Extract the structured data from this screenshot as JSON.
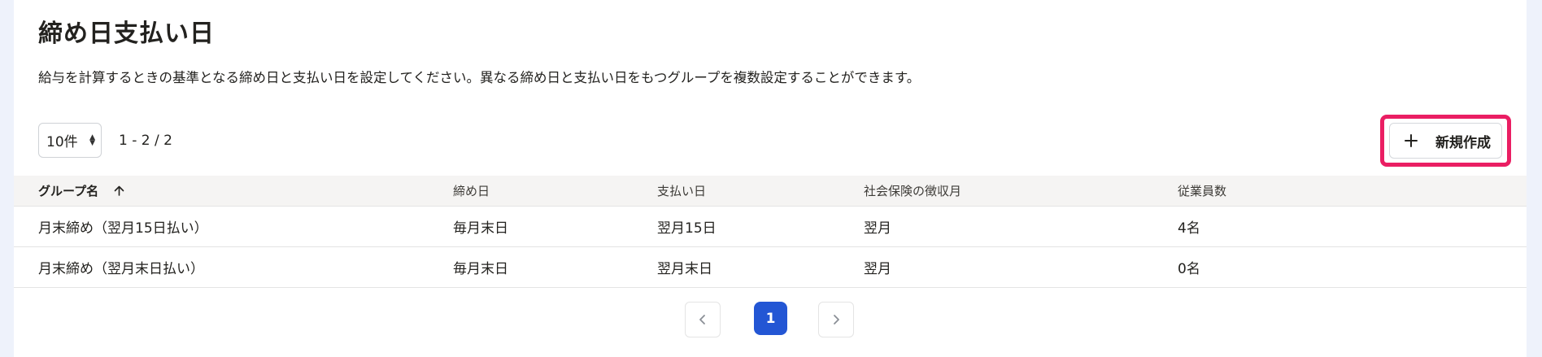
{
  "page": {
    "title": "締め日支払い日",
    "description": "給与を計算するときの基準となる締め日と支払い日を設定してください。異なる締め日と支払い日をもつグループを複数設定することができます。"
  },
  "toolbar": {
    "per_page_value": "10件",
    "range_text": "1 - 2 / 2",
    "new_button_label": "新規作成",
    "new_button_icon": "plus-icon"
  },
  "table": {
    "columns": [
      "グループ名",
      "締め日",
      "支払い日",
      "社会保険の徴収月",
      "従業員数"
    ],
    "sort_icon": "arrow-up-icon",
    "rows": [
      [
        "月末締め（翌月15日払い）",
        "毎月末日",
        "翌月15日",
        "翌月",
        "4名"
      ],
      [
        "月末締め（翌月末日払い）",
        "毎月末日",
        "翌月末日",
        "翌月",
        "0名"
      ]
    ]
  },
  "pagination": {
    "current_page": "1",
    "prev_icon": "chevron-left-icon",
    "next_icon": "chevron-right-icon"
  },
  "colors": {
    "accent": "#2356d4",
    "highlight": "#ea1e63",
    "background": "#eef2fb"
  }
}
